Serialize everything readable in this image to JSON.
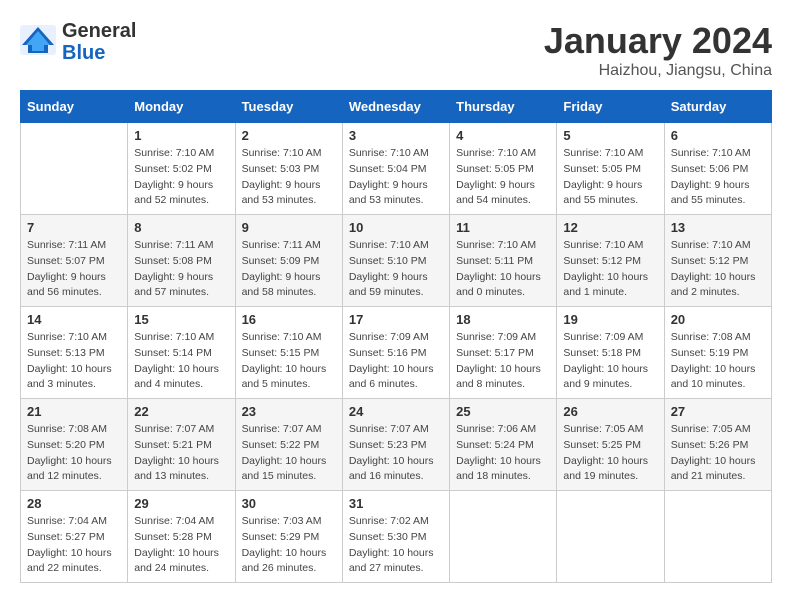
{
  "header": {
    "logo_general": "General",
    "logo_blue": "Blue",
    "month_title": "January 2024",
    "location": "Haizhou, Jiangsu, China"
  },
  "weekdays": [
    "Sunday",
    "Monday",
    "Tuesday",
    "Wednesday",
    "Thursday",
    "Friday",
    "Saturday"
  ],
  "weeks": [
    [
      {
        "day": "",
        "info": ""
      },
      {
        "day": "1",
        "info": "Sunrise: 7:10 AM\nSunset: 5:02 PM\nDaylight: 9 hours\nand 52 minutes."
      },
      {
        "day": "2",
        "info": "Sunrise: 7:10 AM\nSunset: 5:03 PM\nDaylight: 9 hours\nand 53 minutes."
      },
      {
        "day": "3",
        "info": "Sunrise: 7:10 AM\nSunset: 5:04 PM\nDaylight: 9 hours\nand 53 minutes."
      },
      {
        "day": "4",
        "info": "Sunrise: 7:10 AM\nSunset: 5:05 PM\nDaylight: 9 hours\nand 54 minutes."
      },
      {
        "day": "5",
        "info": "Sunrise: 7:10 AM\nSunset: 5:05 PM\nDaylight: 9 hours\nand 55 minutes."
      },
      {
        "day": "6",
        "info": "Sunrise: 7:10 AM\nSunset: 5:06 PM\nDaylight: 9 hours\nand 55 minutes."
      }
    ],
    [
      {
        "day": "7",
        "info": "Sunrise: 7:11 AM\nSunset: 5:07 PM\nDaylight: 9 hours\nand 56 minutes."
      },
      {
        "day": "8",
        "info": "Sunrise: 7:11 AM\nSunset: 5:08 PM\nDaylight: 9 hours\nand 57 minutes."
      },
      {
        "day": "9",
        "info": "Sunrise: 7:11 AM\nSunset: 5:09 PM\nDaylight: 9 hours\nand 58 minutes."
      },
      {
        "day": "10",
        "info": "Sunrise: 7:10 AM\nSunset: 5:10 PM\nDaylight: 9 hours\nand 59 minutes."
      },
      {
        "day": "11",
        "info": "Sunrise: 7:10 AM\nSunset: 5:11 PM\nDaylight: 10 hours\nand 0 minutes."
      },
      {
        "day": "12",
        "info": "Sunrise: 7:10 AM\nSunset: 5:12 PM\nDaylight: 10 hours\nand 1 minute."
      },
      {
        "day": "13",
        "info": "Sunrise: 7:10 AM\nSunset: 5:12 PM\nDaylight: 10 hours\nand 2 minutes."
      }
    ],
    [
      {
        "day": "14",
        "info": "Sunrise: 7:10 AM\nSunset: 5:13 PM\nDaylight: 10 hours\nand 3 minutes."
      },
      {
        "day": "15",
        "info": "Sunrise: 7:10 AM\nSunset: 5:14 PM\nDaylight: 10 hours\nand 4 minutes."
      },
      {
        "day": "16",
        "info": "Sunrise: 7:10 AM\nSunset: 5:15 PM\nDaylight: 10 hours\nand 5 minutes."
      },
      {
        "day": "17",
        "info": "Sunrise: 7:09 AM\nSunset: 5:16 PM\nDaylight: 10 hours\nand 6 minutes."
      },
      {
        "day": "18",
        "info": "Sunrise: 7:09 AM\nSunset: 5:17 PM\nDaylight: 10 hours\nand 8 minutes."
      },
      {
        "day": "19",
        "info": "Sunrise: 7:09 AM\nSunset: 5:18 PM\nDaylight: 10 hours\nand 9 minutes."
      },
      {
        "day": "20",
        "info": "Sunrise: 7:08 AM\nSunset: 5:19 PM\nDaylight: 10 hours\nand 10 minutes."
      }
    ],
    [
      {
        "day": "21",
        "info": "Sunrise: 7:08 AM\nSunset: 5:20 PM\nDaylight: 10 hours\nand 12 minutes."
      },
      {
        "day": "22",
        "info": "Sunrise: 7:07 AM\nSunset: 5:21 PM\nDaylight: 10 hours\nand 13 minutes."
      },
      {
        "day": "23",
        "info": "Sunrise: 7:07 AM\nSunset: 5:22 PM\nDaylight: 10 hours\nand 15 minutes."
      },
      {
        "day": "24",
        "info": "Sunrise: 7:07 AM\nSunset: 5:23 PM\nDaylight: 10 hours\nand 16 minutes."
      },
      {
        "day": "25",
        "info": "Sunrise: 7:06 AM\nSunset: 5:24 PM\nDaylight: 10 hours\nand 18 minutes."
      },
      {
        "day": "26",
        "info": "Sunrise: 7:05 AM\nSunset: 5:25 PM\nDaylight: 10 hours\nand 19 minutes."
      },
      {
        "day": "27",
        "info": "Sunrise: 7:05 AM\nSunset: 5:26 PM\nDaylight: 10 hours\nand 21 minutes."
      }
    ],
    [
      {
        "day": "28",
        "info": "Sunrise: 7:04 AM\nSunset: 5:27 PM\nDaylight: 10 hours\nand 22 minutes."
      },
      {
        "day": "29",
        "info": "Sunrise: 7:04 AM\nSunset: 5:28 PM\nDaylight: 10 hours\nand 24 minutes."
      },
      {
        "day": "30",
        "info": "Sunrise: 7:03 AM\nSunset: 5:29 PM\nDaylight: 10 hours\nand 26 minutes."
      },
      {
        "day": "31",
        "info": "Sunrise: 7:02 AM\nSunset: 5:30 PM\nDaylight: 10 hours\nand 27 minutes."
      },
      {
        "day": "",
        "info": ""
      },
      {
        "day": "",
        "info": ""
      },
      {
        "day": "",
        "info": ""
      }
    ]
  ]
}
